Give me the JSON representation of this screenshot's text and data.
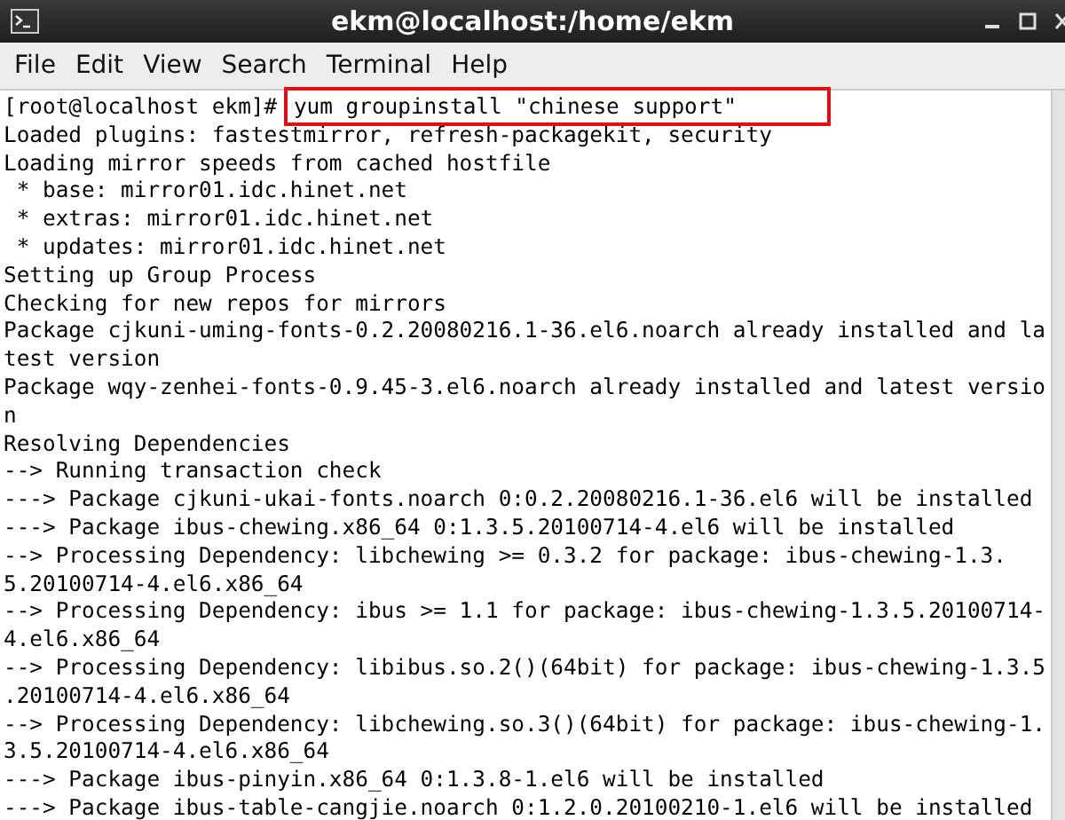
{
  "window": {
    "title": "ekm@localhost:/home/ekm"
  },
  "menu": [
    "File",
    "Edit",
    "View",
    "Search",
    "Terminal",
    "Help"
  ],
  "terminal": {
    "lines": [
      {
        "kind": "prompt",
        "prompt": "[root@localhost ekm]# ",
        "command": "yum groupinstall \"chinese support\"",
        "highlighted": true
      },
      {
        "kind": "output",
        "text": "Loaded plugins: fastestmirror, refresh-packagekit, security"
      },
      {
        "kind": "output",
        "text": "Loading mirror speeds from cached hostfile"
      },
      {
        "kind": "output",
        "text": " * base: mirror01.idc.hinet.net"
      },
      {
        "kind": "output",
        "text": " * extras: mirror01.idc.hinet.net"
      },
      {
        "kind": "output",
        "text": " * updates: mirror01.idc.hinet.net"
      },
      {
        "kind": "output",
        "text": "Setting up Group Process"
      },
      {
        "kind": "output",
        "text": "Checking for new repos for mirrors"
      },
      {
        "kind": "output",
        "text": "Package cjkuni-uming-fonts-0.2.20080216.1-36.el6.noarch already installed and la"
      },
      {
        "kind": "output",
        "text": "test version"
      },
      {
        "kind": "output",
        "text": "Package wqy-zenhei-fonts-0.9.45-3.el6.noarch already installed and latest versio"
      },
      {
        "kind": "output",
        "text": "n"
      },
      {
        "kind": "output",
        "text": "Resolving Dependencies"
      },
      {
        "kind": "output",
        "text": "--> Running transaction check"
      },
      {
        "kind": "output",
        "text": "---> Package cjkuni-ukai-fonts.noarch 0:0.2.20080216.1-36.el6 will be installed"
      },
      {
        "kind": "output",
        "text": "---> Package ibus-chewing.x86_64 0:1.3.5.20100714-4.el6 will be installed"
      },
      {
        "kind": "output",
        "text": "--> Processing Dependency: libchewing >= 0.3.2 for package: ibus-chewing-1.3."
      },
      {
        "kind": "output",
        "text": "5.20100714-4.el6.x86_64"
      },
      {
        "kind": "output",
        "text": "--> Processing Dependency: ibus >= 1.1 for package: ibus-chewing-1.3.5.20100714-"
      },
      {
        "kind": "output",
        "text": "4.el6.x86_64"
      },
      {
        "kind": "output",
        "text": "--> Processing Dependency: libibus.so.2()(64bit) for package: ibus-chewing-1.3.5"
      },
      {
        "kind": "output",
        "text": ".20100714-4.el6.x86_64"
      },
      {
        "kind": "output",
        "text": "--> Processing Dependency: libchewing.so.3()(64bit) for package: ibus-chewing-1."
      },
      {
        "kind": "output",
        "text": "3.5.20100714-4.el6.x86_64"
      },
      {
        "kind": "output",
        "text": "---> Package ibus-pinyin.x86_64 0:1.3.8-1.el6 will be installed"
      },
      {
        "kind": "output",
        "text": "---> Package ibus-table-cangjie.noarch 0:1.2.0.20100210-1.el6 will be installed"
      }
    ]
  }
}
